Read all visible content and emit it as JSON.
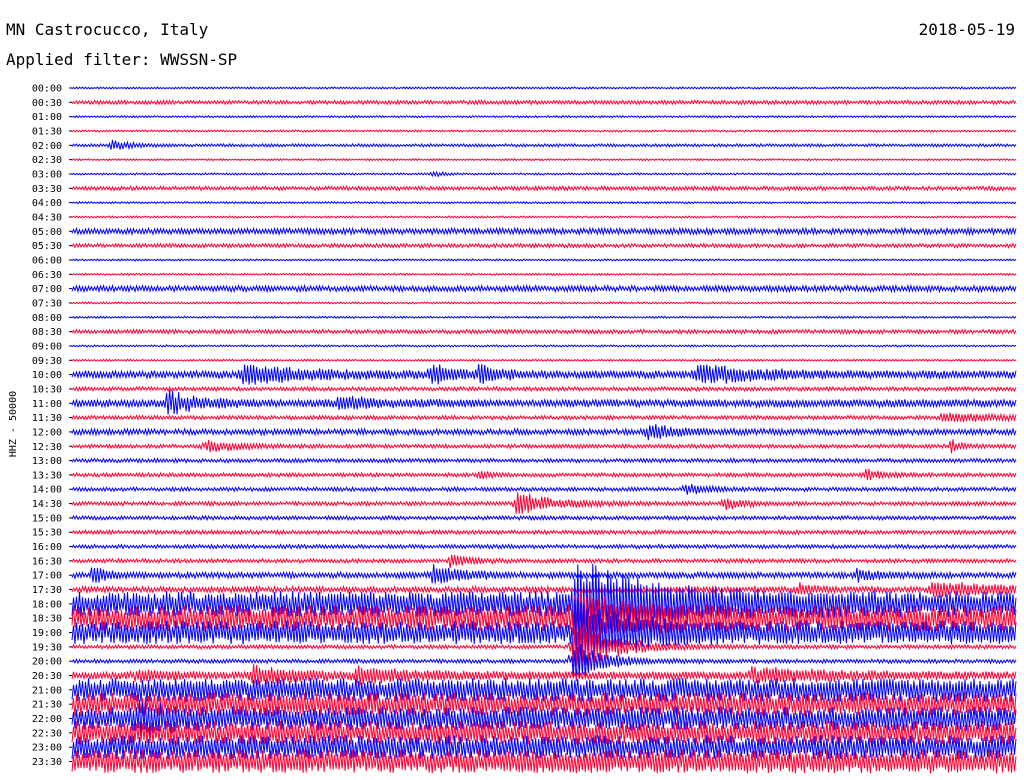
{
  "header": {
    "title": "MN Castrocucco, Italy",
    "filter": "Applied filter: WWSSN-SP",
    "date": "2018-05-19"
  },
  "chart_data": {
    "type": "line",
    "title": "MN Castrocucco, Italy",
    "subtitle": "Applied filter: WWSSN-SP",
    "ylabel": "HHZ - 50000",
    "trace_colors": [
      "#0000ff",
      "#ff0033"
    ],
    "line_labels": [
      "00:00",
      "00:30",
      "01:00",
      "01:30",
      "02:00",
      "02:30",
      "03:00",
      "03:30",
      "04:00",
      "04:30",
      "05:00",
      "05:30",
      "06:00",
      "06:30",
      "07:00",
      "07:30",
      "08:00",
      "08:30",
      "09:00",
      "09:30",
      "10:00",
      "10:30",
      "11:00",
      "11:30",
      "12:00",
      "12:30",
      "13:00",
      "13:30",
      "14:00",
      "14:30",
      "15:00",
      "15:30",
      "16:00",
      "16:30",
      "17:00",
      "17:30",
      "18:00",
      "18:30",
      "19:00",
      "19:30",
      "20:00",
      "20:30",
      "21:00",
      "21:30",
      "22:00",
      "22:30",
      "23:00",
      "23:30"
    ],
    "noise_level": [
      1,
      2,
      1,
      1,
      1.5,
      1,
      1,
      2,
      1,
      1,
      3,
      2,
      1,
      1,
      3,
      1,
      1,
      2,
      1,
      1,
      4,
      2,
      4,
      2,
      3,
      2,
      2,
      2,
      2,
      2,
      2,
      2,
      2,
      2,
      3,
      3,
      13,
      13,
      12,
      2,
      2,
      4,
      12,
      12,
      12,
      12,
      12,
      12
    ],
    "events": [
      {
        "line": 4,
        "t": 0.04,
        "amp": 5,
        "dur": 0.02
      },
      {
        "line": 6,
        "t": 0.38,
        "amp": 4,
        "dur": 0.01
      },
      {
        "line": 20,
        "t": 0.18,
        "amp": 11,
        "dur": 0.06
      },
      {
        "line": 20,
        "t": 0.38,
        "amp": 10,
        "dur": 0.02
      },
      {
        "line": 20,
        "t": 0.43,
        "amp": 10,
        "dur": 0.02
      },
      {
        "line": 20,
        "t": 0.66,
        "amp": 10,
        "dur": 0.06
      },
      {
        "line": 22,
        "t": 0.1,
        "amp": 12,
        "dur": 0.03
      },
      {
        "line": 22,
        "t": 0.28,
        "amp": 6,
        "dur": 0.04
      },
      {
        "line": 23,
        "t": 0.92,
        "amp": 4,
        "dur": 0.08
      },
      {
        "line": 24,
        "t": 0.61,
        "amp": 8,
        "dur": 0.03
      },
      {
        "line": 25,
        "t": 0.14,
        "amp": 7,
        "dur": 0.03
      },
      {
        "line": 25,
        "t": 0.93,
        "amp": 8,
        "dur": 0.01
      },
      {
        "line": 27,
        "t": 0.43,
        "amp": 5,
        "dur": 0.01
      },
      {
        "line": 27,
        "t": 0.84,
        "amp": 5,
        "dur": 0.02
      },
      {
        "line": 28,
        "t": 0.65,
        "amp": 6,
        "dur": 0.02
      },
      {
        "line": 29,
        "t": 0.47,
        "amp": 12,
        "dur": 0.04
      },
      {
        "line": 29,
        "t": 0.69,
        "amp": 6,
        "dur": 0.02
      },
      {
        "line": 33,
        "t": 0.4,
        "amp": 7,
        "dur": 0.02
      },
      {
        "line": 34,
        "t": 0.02,
        "amp": 9,
        "dur": 0.02
      },
      {
        "line": 34,
        "t": 0.38,
        "amp": 11,
        "dur": 0.03
      },
      {
        "line": 34,
        "t": 0.83,
        "amp": 6,
        "dur": 0.02
      },
      {
        "line": 35,
        "t": 0.77,
        "amp": 9,
        "dur": 0.01
      },
      {
        "line": 35,
        "t": 0.91,
        "amp": 7,
        "dur": 0.09
      },
      {
        "line": 36,
        "t": 0.53,
        "amp": 38,
        "dur": 0.08
      },
      {
        "line": 37,
        "t": 0.53,
        "amp": 20,
        "dur": 0.06
      },
      {
        "line": 38,
        "t": 0.53,
        "amp": 30,
        "dur": 0.05
      },
      {
        "line": 39,
        "t": 0.53,
        "amp": 28,
        "dur": 0.04
      },
      {
        "line": 40,
        "t": 0.53,
        "amp": 25,
        "dur": 0.03
      },
      {
        "line": 41,
        "t": 0.07,
        "amp": 8,
        "dur": 0.02
      },
      {
        "line": 41,
        "t": 0.19,
        "amp": 8,
        "dur": 0.06
      },
      {
        "line": 41,
        "t": 0.3,
        "amp": 6,
        "dur": 0.07
      },
      {
        "line": 41,
        "t": 0.72,
        "amp": 7,
        "dur": 0.08
      },
      {
        "line": 44,
        "t": 0.07,
        "amp": 10,
        "dur": 0.03
      }
    ]
  }
}
